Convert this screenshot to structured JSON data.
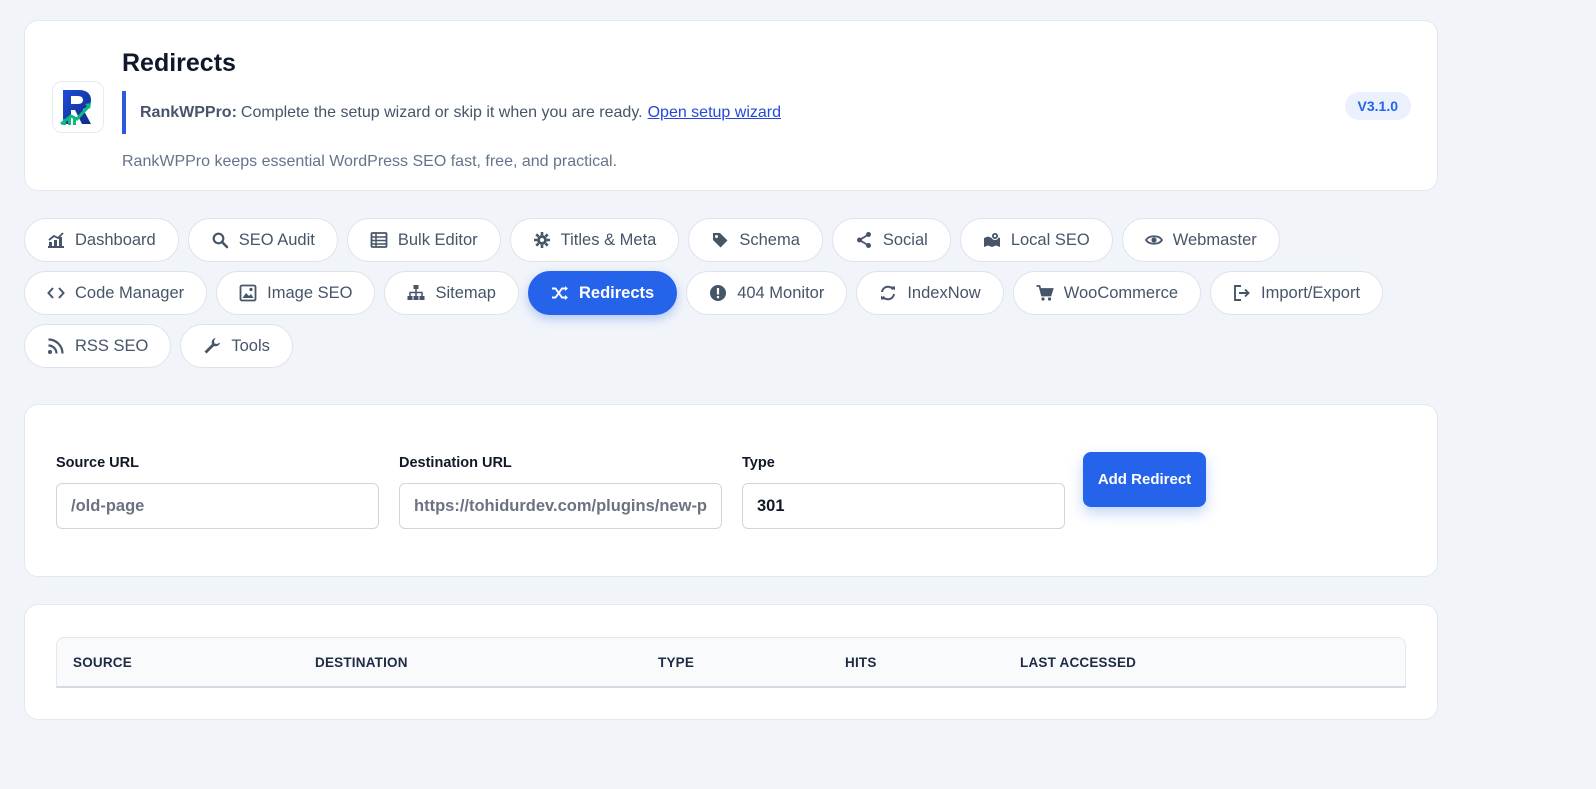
{
  "header": {
    "title": "Redirects",
    "notice_brand": "RankWPPro:",
    "notice_text": "Complete the setup wizard or skip it when you are ready.",
    "notice_link": "Open setup wizard",
    "tagline": "RankWPPro keeps essential WordPress SEO fast, free, and practical.",
    "version": "V3.1.0",
    "logo_letter": "R"
  },
  "tabs": [
    {
      "label": "Dashboard",
      "icon": "chart-line-icon"
    },
    {
      "label": "SEO Audit",
      "icon": "search-icon"
    },
    {
      "label": "Bulk Editor",
      "icon": "table-icon"
    },
    {
      "label": "Titles & Meta",
      "icon": "gear-icon"
    },
    {
      "label": "Schema",
      "icon": "tag-icon"
    },
    {
      "label": "Social",
      "icon": "share-icon"
    },
    {
      "label": "Local SEO",
      "icon": "map-pin-icon"
    },
    {
      "label": "Webmaster",
      "icon": "eye-icon"
    },
    {
      "label": "Code Manager",
      "icon": "code-icon"
    },
    {
      "label": "Image SEO",
      "icon": "image-icon"
    },
    {
      "label": "Sitemap",
      "icon": "sitemap-icon"
    },
    {
      "label": "Redirects",
      "icon": "shuffle-icon",
      "active": true
    },
    {
      "label": "404 Monitor",
      "icon": "alert-circle-icon"
    },
    {
      "label": "IndexNow",
      "icon": "sync-icon"
    },
    {
      "label": "WooCommerce",
      "icon": "cart-icon"
    },
    {
      "label": "Import/Export",
      "icon": "export-icon"
    },
    {
      "label": "RSS SEO",
      "icon": "rss-icon"
    },
    {
      "label": "Tools",
      "icon": "wrench-icon"
    }
  ],
  "form": {
    "source_label": "Source URL",
    "source_placeholder": "/old-page",
    "destination_label": "Destination URL",
    "destination_placeholder": "https://tohidurdev.com/plugins/new-page",
    "type_label": "Type",
    "type_value": "301",
    "add_button": "Add Redirect"
  },
  "table": {
    "columns": [
      "SOURCE",
      "DESTINATION",
      "TYPE",
      "HITS",
      "LAST ACCESSED"
    ]
  },
  "colors": {
    "accent": "#2563eb",
    "background": "#f1f4f9",
    "card": "#ffffff"
  }
}
